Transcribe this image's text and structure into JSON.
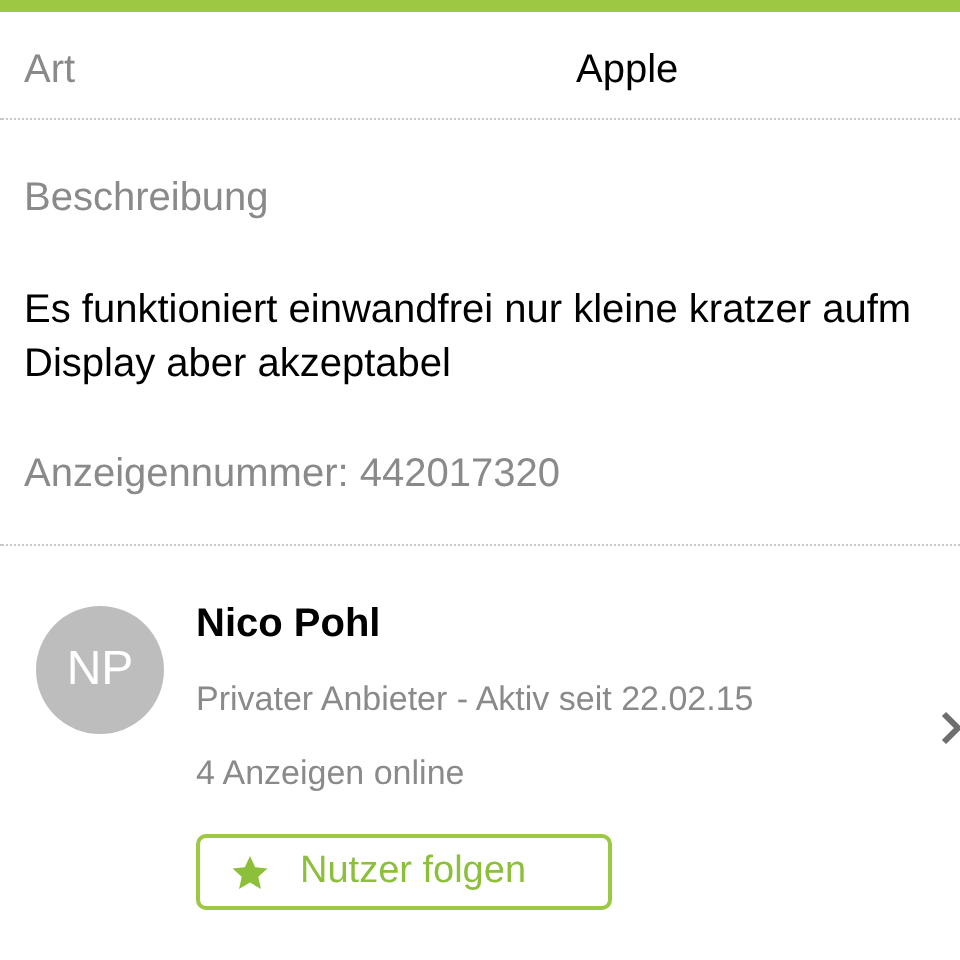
{
  "details": [
    {
      "label": "Art",
      "value": "Apple"
    }
  ],
  "description": {
    "heading": "Beschreibung",
    "text": "Es funktioniert einwandfrei nur kleine kratzer aufm Display aber akzeptabel",
    "ad_number": "Anzeigennummer: 442017320"
  },
  "seller": {
    "initials": "NP",
    "name": "Nico Pohl",
    "subtitle": "Privater Anbieter - Aktiv seit 22.02.15",
    "ads_online": "4 Anzeigen online",
    "follow_button": "Nutzer folgen"
  }
}
